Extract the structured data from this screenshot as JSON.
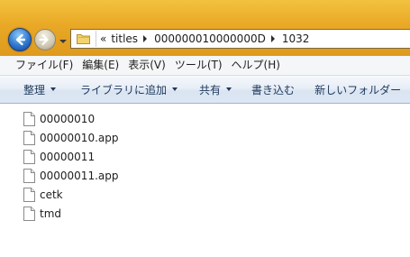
{
  "address_bar": {
    "overflow_label": "«",
    "breadcrumbs": [
      "titles",
      "000000010000000D",
      "1032"
    ]
  },
  "menu": {
    "items": [
      "ファイル(F)",
      "編集(E)",
      "表示(V)",
      "ツール(T)",
      "ヘルプ(H)"
    ]
  },
  "command_bar": {
    "organize": "整理",
    "add_to_library": "ライブラリに追加",
    "share": "共有",
    "burn": "書き込む",
    "new_folder": "新しいフォルダー"
  },
  "files": [
    {
      "name": "00000010",
      "icon": "generic-file-icon"
    },
    {
      "name": "00000010.app",
      "icon": "generic-file-icon"
    },
    {
      "name": "00000011",
      "icon": "generic-file-icon"
    },
    {
      "name": "00000011.app",
      "icon": "generic-file-icon"
    },
    {
      "name": "cetk",
      "icon": "generic-file-icon"
    },
    {
      "name": "tmd",
      "icon": "generic-file-icon"
    }
  ],
  "colors": {
    "glass": "#e9a826",
    "back_button": "#2e77d0",
    "command_text": "#1e395b"
  }
}
